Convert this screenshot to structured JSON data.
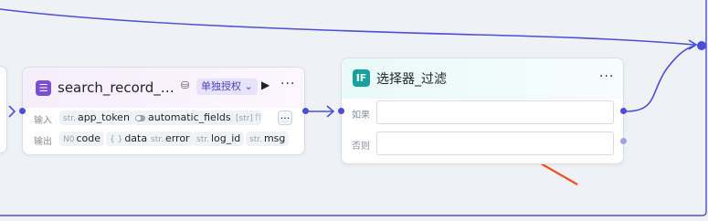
{
  "search_node": {
    "title": "search_record_查…",
    "auth_badge": "单独授权",
    "input_label": "输入",
    "output_label": "输出",
    "inputs": [
      {
        "type": "str.",
        "name": "app_token"
      },
      {
        "type": "",
        "name": "automatic_fields"
      },
      {
        "type": "[str]",
        "name": "fie"
      }
    ],
    "outputs": [
      {
        "type": "N0",
        "name": "code"
      },
      {
        "type": "{ }",
        "name": "data"
      },
      {
        "type": "str.",
        "name": "error"
      },
      {
        "type": "str.",
        "name": "log_id"
      },
      {
        "type": "str.",
        "name": "msg"
      }
    ],
    "more_chip": "···"
  },
  "if_node": {
    "icon_label": "IF",
    "title": "选择器_过滤",
    "if_label": "如果",
    "else_label": "否则",
    "if_value": "",
    "else_value": ""
  },
  "colors": {
    "wire": "#4a4fd6",
    "arrow": "#f0501e",
    "canvas": "#eff1f6"
  }
}
